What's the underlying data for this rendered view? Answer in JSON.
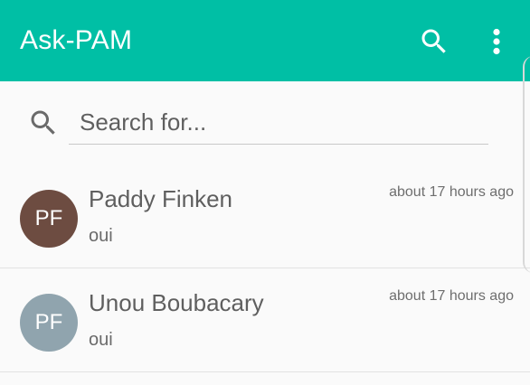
{
  "toolbar": {
    "title": "Ask-PAM",
    "search_icon": "search-icon",
    "more_icon": "more-vert-icon",
    "background": "#00bfa5"
  },
  "search": {
    "placeholder": "Search for...",
    "value": "",
    "icon": "search-icon"
  },
  "conversations": [
    {
      "initials": "PF",
      "name": "Paddy Finken",
      "last_message": "oui",
      "time": "about 17 hours ago",
      "avatar_color": "#6d4c41"
    },
    {
      "initials": "PF",
      "name": "Unou Boubacary",
      "last_message": "oui",
      "time": "about 17 hours ago",
      "avatar_color": "#90a4ae"
    }
  ]
}
